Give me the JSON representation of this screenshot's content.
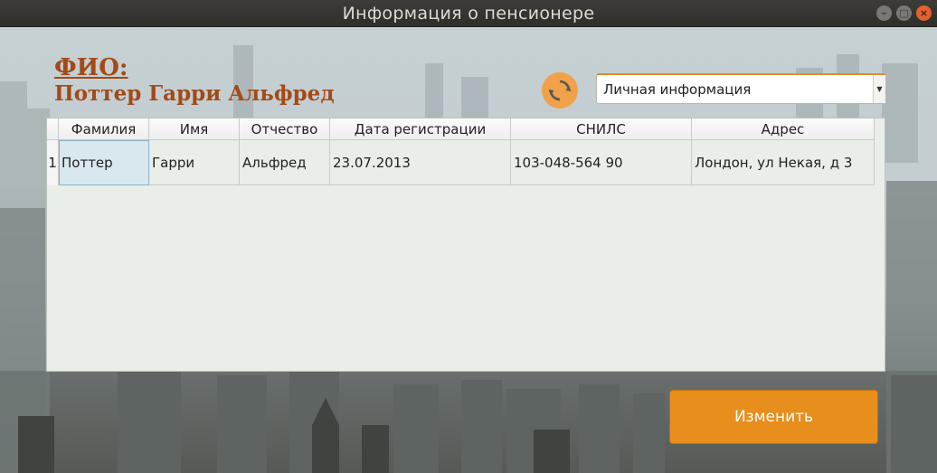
{
  "window": {
    "title": "Информация о пенсионере"
  },
  "header": {
    "fio_label": "ФИО:",
    "fio_name": "Поттер Гарри Альфред"
  },
  "combo": {
    "selected": "Личная информация"
  },
  "table": {
    "columns": [
      "Фамилия",
      "Имя",
      "Отчество",
      "Дата регистрации",
      "СНИЛС",
      "Адрес"
    ],
    "rows": [
      {
        "num": "1",
        "cells": [
          "Поттер",
          "Гарри",
          "Альфред",
          "23.07.2013",
          "103-048-564 90",
          "Лондон, ул Некая, д 3"
        ]
      }
    ]
  },
  "actions": {
    "edit_label": "Изменить"
  },
  "icons": {
    "refresh": "refresh-icon",
    "minimize": "minimize-icon",
    "maximize": "maximize-icon",
    "close": "close-icon",
    "dropdown": "chevron-down-icon"
  },
  "colors": {
    "accent": "#e88e1c",
    "heading": "#a34a17"
  }
}
